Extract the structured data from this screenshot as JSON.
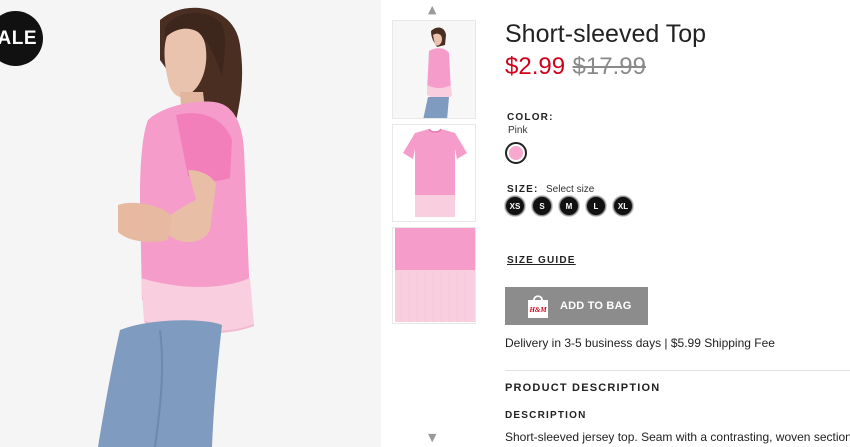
{
  "badge": {
    "sale": "SALE"
  },
  "product": {
    "title": "Short-sleeved Top",
    "price_sale": "$2.99",
    "price_original": "$17.99"
  },
  "color": {
    "label": "COLOR:",
    "selected": "Pink",
    "swatch_hex": "#f6a8cf"
  },
  "size": {
    "label": "SIZE:",
    "hint": "Select size",
    "options": [
      "XS",
      "S",
      "M",
      "L",
      "XL"
    ]
  },
  "size_guide": "SIZE GUIDE",
  "add_to_bag": {
    "label": "ADD TO BAG",
    "icon": "shopping-bag-icon",
    "logo_text": "H&M"
  },
  "delivery": "Delivery in 3-5 business days | $5.99 Shipping Fee",
  "product_description_heading": "PRODUCT DESCRIPTION",
  "description": {
    "label": "DESCRIPTION",
    "text": "Short-sleeved jersey top. Seam with a contrasting, woven section"
  },
  "gallery": {
    "up_icon": "chevron-up-icon",
    "down_icon": "chevron-down-icon",
    "thumbnails": [
      "model-side-view",
      "top-front-flat",
      "top-detail-closeup"
    ]
  },
  "colors": {
    "sale_price": "#d0021b",
    "button_bg": "#8c8c8c",
    "top_pink": "#f59ccb",
    "hem_pink": "#f9cfe0"
  }
}
